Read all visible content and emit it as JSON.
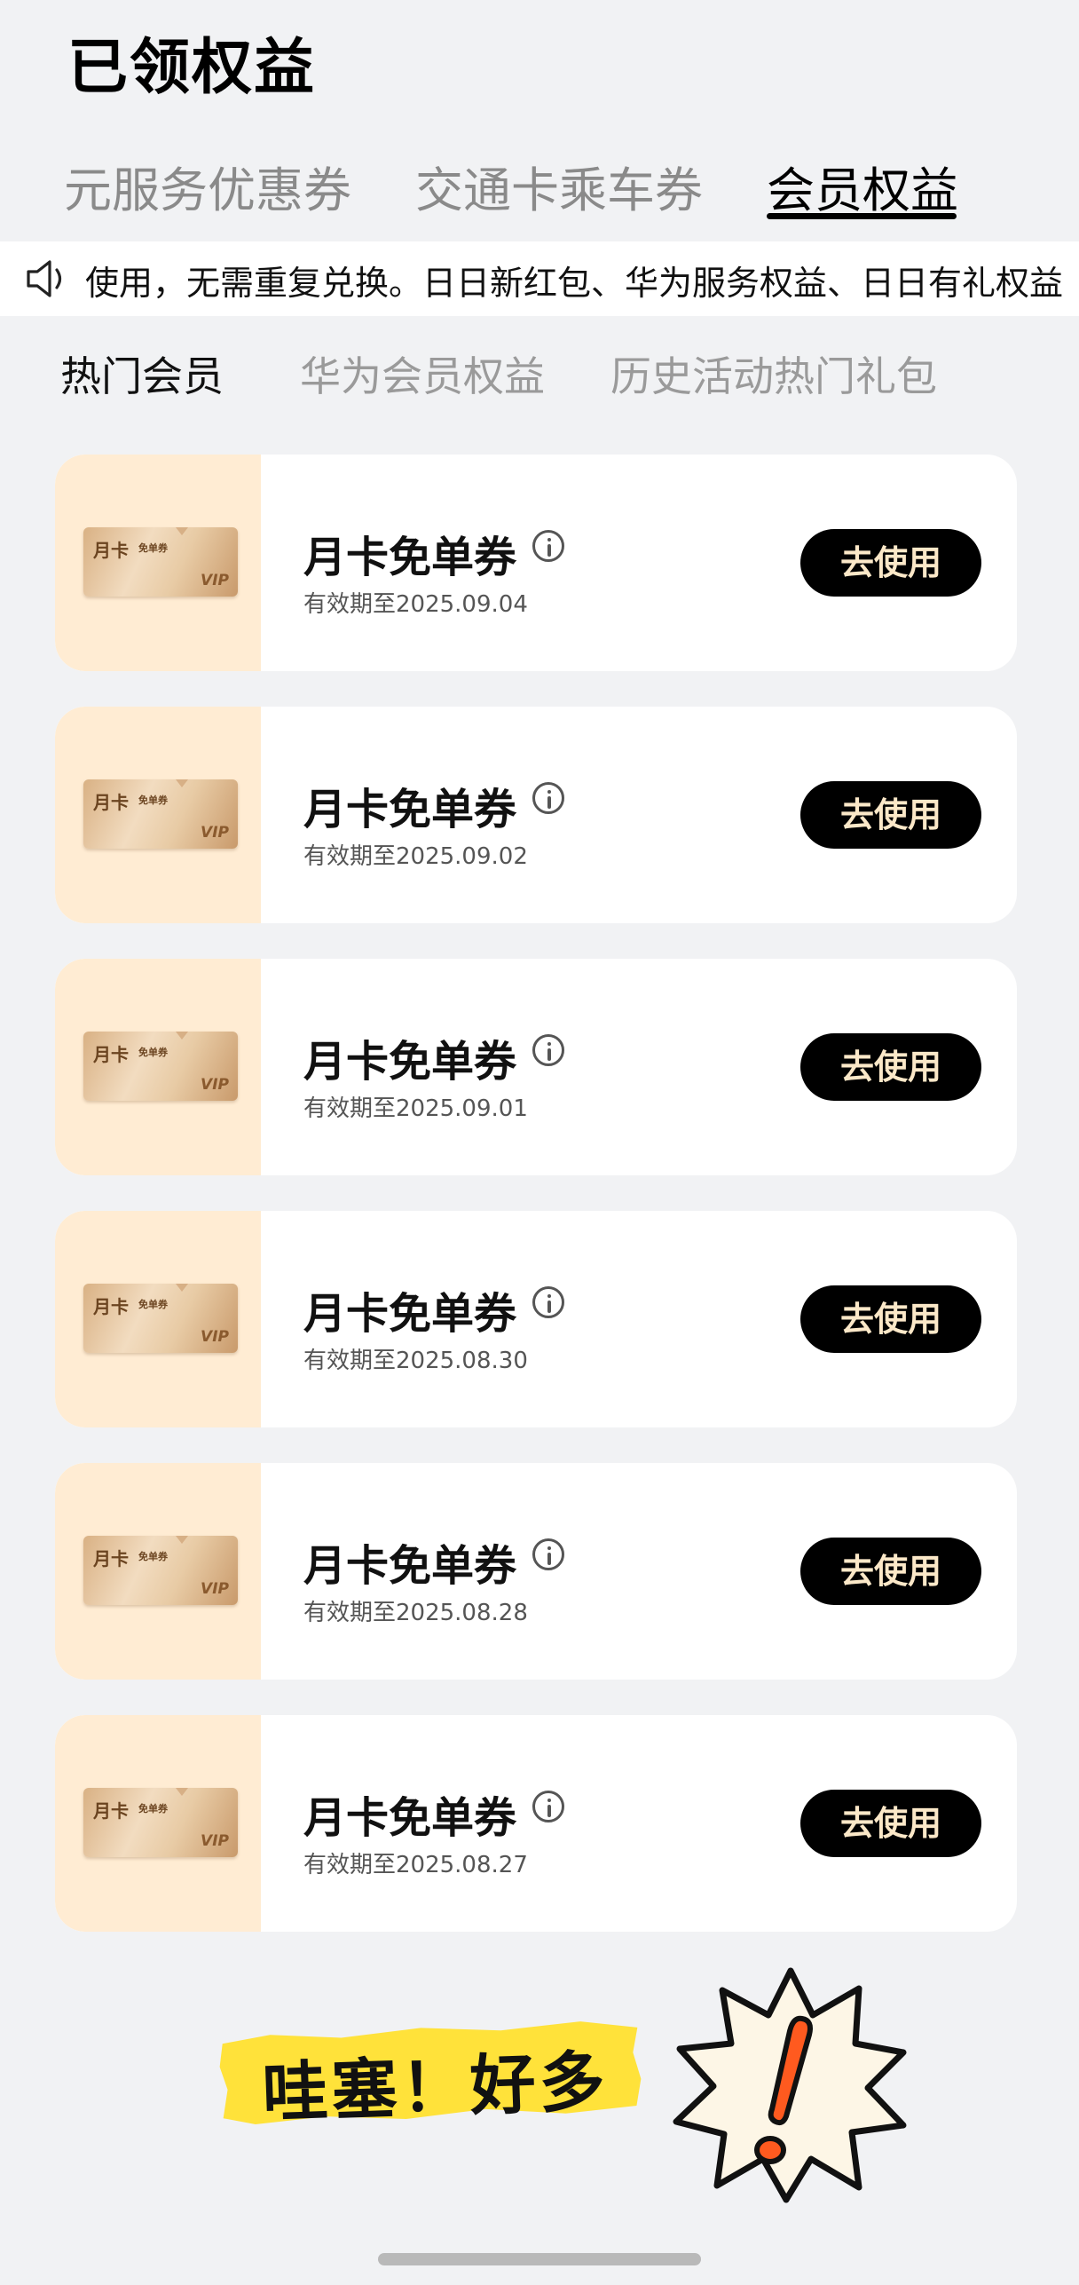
{
  "page": {
    "title": "已领权益"
  },
  "tabs": [
    {
      "label": "元服务优惠券",
      "active": false
    },
    {
      "label": "交通卡乘车券",
      "active": false
    },
    {
      "label": "会员权益",
      "active": true
    }
  ],
  "notice": {
    "icon": "speaker-icon",
    "text": "使用，无需重复兑换。日日新红包、华为服务权益、日日有礼权益"
  },
  "subtabs": [
    {
      "label": "热门会员",
      "active": true
    },
    {
      "label": "华为会员权益",
      "active": false
    },
    {
      "label": "历史活动热门礼包",
      "active": false
    }
  ],
  "coupon_thumb": {
    "title": "月卡",
    "subtitle": "免单券",
    "mark": "VIP"
  },
  "coupons": [
    {
      "name": "月卡免单券",
      "expiry": "有效期至2025.09.04",
      "button": "去使用"
    },
    {
      "name": "月卡免单券",
      "expiry": "有效期至2025.09.02",
      "button": "去使用"
    },
    {
      "name": "月卡免单券",
      "expiry": "有效期至2025.09.01",
      "button": "去使用"
    },
    {
      "name": "月卡免单券",
      "expiry": "有效期至2025.08.30",
      "button": "去使用"
    },
    {
      "name": "月卡免单券",
      "expiry": "有效期至2025.08.28",
      "button": "去使用"
    },
    {
      "name": "月卡免单券",
      "expiry": "有效期至2025.08.27",
      "button": "去使用"
    }
  ],
  "sticker": {
    "text": "哇塞！好多",
    "icon": "exclamation-burst-icon"
  },
  "colors": {
    "background": "#f1f2f4",
    "thumb_bg": "#ffecd3",
    "button_bg": "#000000",
    "button_text": "#fbe8c8",
    "sticker_yellow": "#ffe23a",
    "exclamation": "#ff5a1f"
  }
}
